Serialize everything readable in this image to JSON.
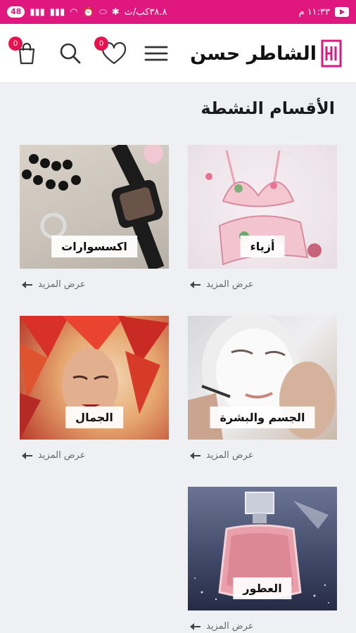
{
  "status_bar": {
    "time": "١١:٣٣ م",
    "speed": "٣٨.٨كب/ث",
    "battery": "48"
  },
  "header": {
    "brand": "الشاطر حسن",
    "cart_count": "0",
    "wishlist_count": "0",
    "icons": [
      "menu-icon",
      "heart-icon",
      "search-icon",
      "shopping-bag-icon"
    ],
    "accent_color": "#e0177f"
  },
  "main": {
    "title": "الأقسام النشطة",
    "categories": [
      {
        "label": "أزياء",
        "more": "عرض المزيد"
      },
      {
        "label": "اكسسوارات",
        "more": "عرض المزيد"
      },
      {
        "label": "الجسم والبشرة",
        "more": "عرض المزيد"
      },
      {
        "label": "الجمال",
        "more": "عرض المزيد"
      },
      {
        "label": "العطور",
        "more": "عرض المزيد"
      }
    ]
  }
}
